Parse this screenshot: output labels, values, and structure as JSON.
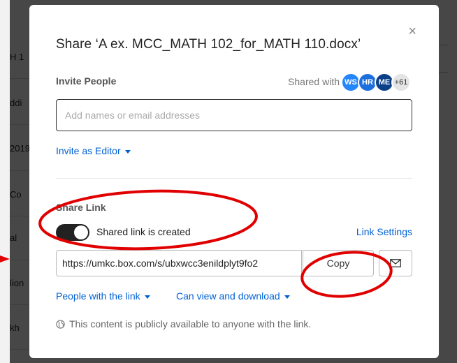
{
  "background": {
    "left_fragments": [
      "H 1",
      "ddi",
      "2019",
      "Co",
      "al",
      "lion",
      "kh"
    ],
    "overlay_color": "#000000"
  },
  "dialog": {
    "title": "Share ‘A ex. MCC_MATH 102_for_MATH 110.docx’",
    "close_glyph": "×",
    "invite": {
      "label": "Invite People",
      "shared_with_label": "Shared with",
      "avatars": [
        "WS",
        "HR",
        "ME"
      ],
      "more_count": "+61",
      "input_placeholder": "Add names or email addresses",
      "input_value": "",
      "role_link": "Invite as Editor"
    },
    "share_link": {
      "label": "Share Link",
      "toggle_on": true,
      "toggle_text": "Shared link is created",
      "settings_link": "Link Settings",
      "url": "https://umkc.box.com/s/ubxwcc3enildplyt9fo2",
      "copy_label": "Copy",
      "mail_icon": "mail-icon",
      "people_dropdown": "People with the link",
      "access_dropdown": "Can view and download",
      "public_note": "This content is publicly available to anyone with the link."
    }
  },
  "colors": {
    "accent_blue": "#0061d5",
    "annotation_red": "#e00000",
    "toggle_on": "#222222"
  }
}
